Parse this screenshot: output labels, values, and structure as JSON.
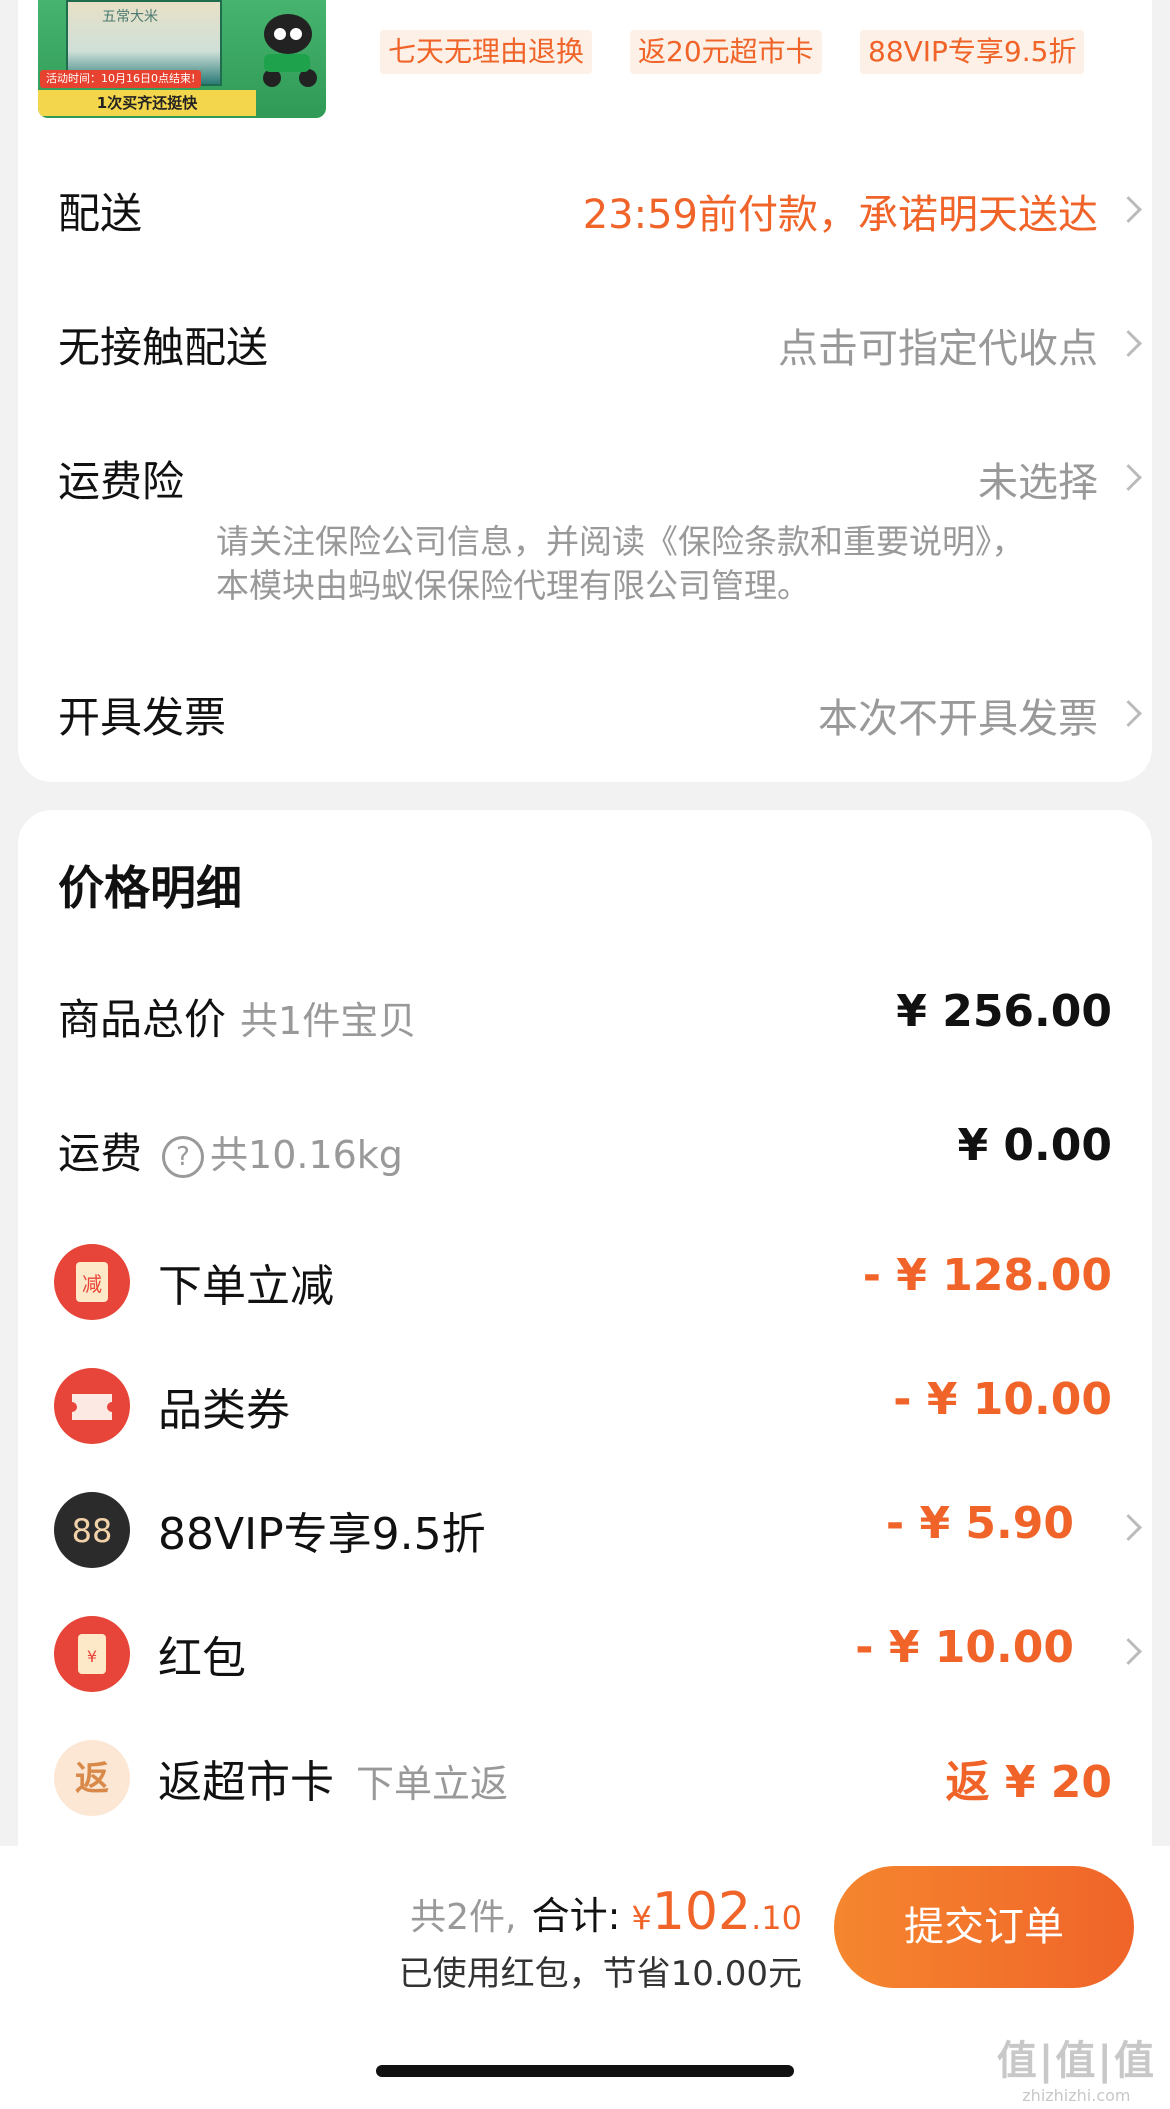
{
  "product": {
    "image_tag_time": "活动时间：10月16日0点结束!",
    "image_tag_promo": "1次买齐还挺快",
    "image_box_text": "五常大米",
    "chips": [
      "七天无理由退换",
      "返20元超市卡",
      "88VIP专享9.5折"
    ]
  },
  "delivery": {
    "label": "配送",
    "value": "23:59前付款，承诺明天送达"
  },
  "contactless": {
    "label": "无接触配送",
    "value": "点击可指定代收点"
  },
  "freight_insurance": {
    "label": "运费险",
    "value": "未选择",
    "note": "请关注保险公司信息，并阅读《保险条款和重要说明》，本模块由蚂蚁保保险代理有限公司管理。"
  },
  "invoice": {
    "label": "开具发票",
    "value": "本次不开具发票"
  },
  "price_detail": {
    "title": "价格明细",
    "subtotal": {
      "label": "商品总价",
      "sub": "共1件宝贝",
      "value": "¥ 256.00"
    },
    "shipping": {
      "label": "运费",
      "help": "?",
      "sub": "共10.16kg",
      "value": "¥ 0.00"
    },
    "discounts": [
      {
        "label": "下单立减",
        "icon": "减",
        "value": "- ¥ 128.00"
      },
      {
        "label": "品类券",
        "icon": "",
        "value": "- ¥ 10.00"
      },
      {
        "label": "88VIP专享9.5折",
        "icon": "88",
        "value": "- ¥ 5.90"
      },
      {
        "label": "红包",
        "icon": "¥",
        "value": "- ¥ 10.00"
      }
    ],
    "cashback": {
      "label": "返超市卡",
      "icon": "返",
      "sub": "下单立返",
      "value": "返 ¥ 20"
    }
  },
  "footer": {
    "count": "共2件,",
    "total_label": "合计:",
    "currency": "¥",
    "total_int": "102",
    "total_dec": ".10",
    "savings": "已使用红包，节省10.00元",
    "submit_label": "提交订单"
  },
  "watermark": {
    "big": "值|值|值",
    "small": "zhizhizhi.com"
  },
  "colors": {
    "accent": "#f06429",
    "icon_red": "#e8453a",
    "icon_dark": "#2b2b2b"
  }
}
